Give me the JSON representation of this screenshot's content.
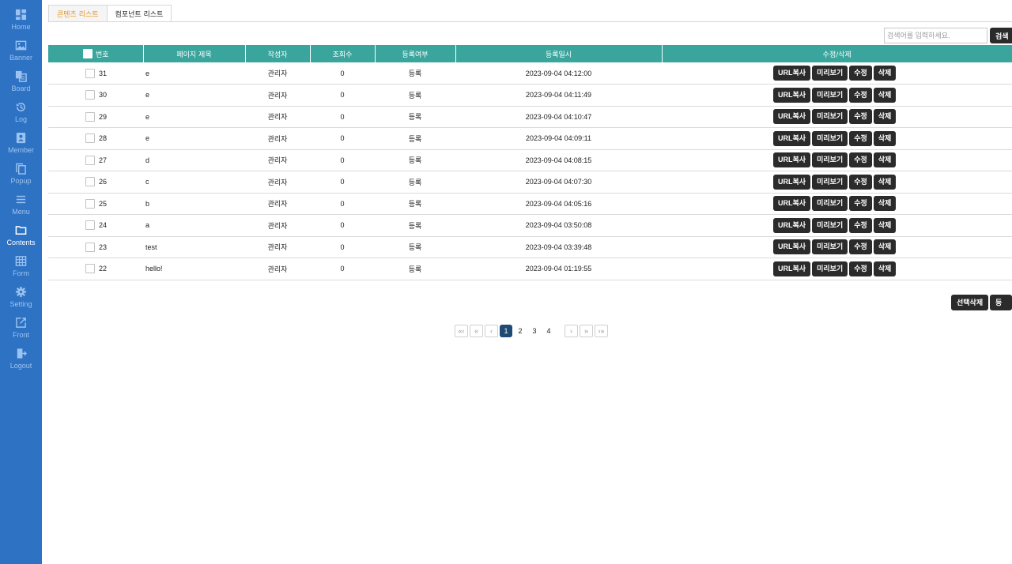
{
  "sidebar": {
    "items": [
      {
        "label": "Home",
        "icon": "dashboard-icon"
      },
      {
        "label": "Banner",
        "icon": "image-icon"
      },
      {
        "label": "Board",
        "icon": "board-icon"
      },
      {
        "label": "Log",
        "icon": "history-icon"
      },
      {
        "label": "Member",
        "icon": "member-icon"
      },
      {
        "label": "Popup",
        "icon": "copy-icon"
      },
      {
        "label": "Menu",
        "icon": "menu-icon"
      },
      {
        "label": "Contents",
        "icon": "folder-icon"
      },
      {
        "label": "Form",
        "icon": "table-icon"
      },
      {
        "label": "Setting",
        "icon": "gear-icon"
      },
      {
        "label": "Front",
        "icon": "external-link-icon"
      },
      {
        "label": "Logout",
        "icon": "logout-icon"
      }
    ],
    "active": "Contents",
    "colors": {
      "bg": "#2e72c4",
      "inactive": "#9cc3f0",
      "active": "#ffffff"
    }
  },
  "tabs": [
    {
      "label": "콘텐츠 리스트",
      "active": true
    },
    {
      "label": "컴포넌트 리스트",
      "active": false
    }
  ],
  "search": {
    "placeholder": "검색어를 입력하세요.",
    "value": "",
    "button_label": "검색"
  },
  "table": {
    "header_color": "#3aa59d",
    "columns": [
      "번호",
      "페이지 제목",
      "작성자",
      "조회수",
      "등록여부",
      "등록일시",
      "수정/삭제"
    ],
    "action_labels": [
      "URL복사",
      "미리보기",
      "수정",
      "삭제"
    ],
    "rows": [
      {
        "num": "31",
        "title": "e",
        "author": "관리자",
        "views": "0",
        "status": "등록",
        "date": "2023-09-04 04:12:00"
      },
      {
        "num": "30",
        "title": "e",
        "author": "관리자",
        "views": "0",
        "status": "등록",
        "date": "2023-09-04 04:11:49"
      },
      {
        "num": "29",
        "title": "e",
        "author": "관리자",
        "views": "0",
        "status": "등록",
        "date": "2023-09-04 04:10:47"
      },
      {
        "num": "28",
        "title": "e",
        "author": "관리자",
        "views": "0",
        "status": "등록",
        "date": "2023-09-04 04:09:11"
      },
      {
        "num": "27",
        "title": "d",
        "author": "관리자",
        "views": "0",
        "status": "등록",
        "date": "2023-09-04 04:08:15"
      },
      {
        "num": "26",
        "title": "c",
        "author": "관리자",
        "views": "0",
        "status": "등록",
        "date": "2023-09-04 04:07:30"
      },
      {
        "num": "25",
        "title": "b",
        "author": "관리자",
        "views": "0",
        "status": "등록",
        "date": "2023-09-04 04:05:16"
      },
      {
        "num": "24",
        "title": "a",
        "author": "관리자",
        "views": "0",
        "status": "등록",
        "date": "2023-09-04 03:50:08"
      },
      {
        "num": "23",
        "title": "test",
        "author": "관리자",
        "views": "0",
        "status": "등록",
        "date": "2023-09-04 03:39:48"
      },
      {
        "num": "22",
        "title": "hello!",
        "author": "관리자",
        "views": "0",
        "status": "등록",
        "date": "2023-09-04 01:19:55"
      }
    ]
  },
  "bottom_actions": {
    "delete_selected": "선택삭제",
    "register": "등록"
  },
  "pagination": {
    "first": "«‹",
    "prev_group": "«",
    "prev": "‹",
    "pages": [
      "1",
      "2",
      "3",
      "4"
    ],
    "current": "1",
    "next": "›",
    "next_group": "»",
    "last": "›»"
  }
}
